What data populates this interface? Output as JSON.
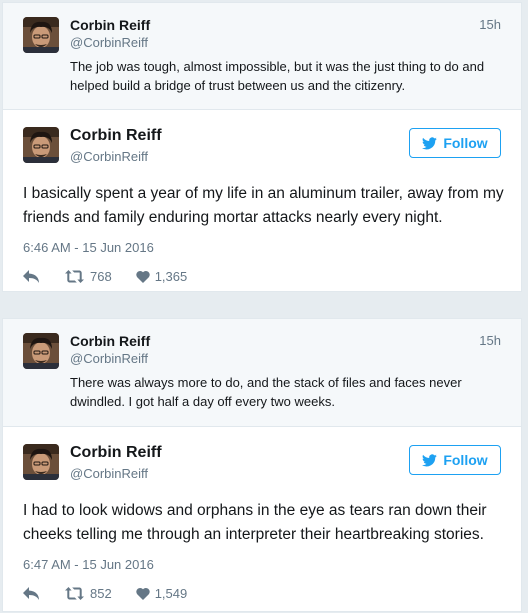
{
  "thread": [
    {
      "parent": {
        "name": "Corbin Reiff",
        "handle": "@CorbinReiff",
        "time": "15h",
        "text": "The job was tough, almost impossible, but it was the just thing to do and helped build a bridge of trust between us and the citizenry."
      },
      "tweet": {
        "name": "Corbin Reiff",
        "handle": "@CorbinReiff",
        "follow_label": "Follow",
        "text": "I basically spent a year of my life in an aluminum trailer, away from my friends and family enduring mortar attacks nearly every night.",
        "date": "6:46 AM - 15 Jun 2016",
        "retweets": "768",
        "likes": "1,365"
      }
    },
    {
      "parent": {
        "name": "Corbin Reiff",
        "handle": "@CorbinReiff",
        "time": "15h",
        "text": "There was always more to do, and the stack of files and faces never dwindled. I got half a day off every two weeks."
      },
      "tweet": {
        "name": "Corbin Reiff",
        "handle": "@CorbinReiff",
        "follow_label": "Follow",
        "text": "I had to look widows and orphans in the eye as tears ran down their cheeks telling me through an interpreter their heartbreaking stories.",
        "date": "6:47 AM - 15 Jun 2016",
        "retweets": "852",
        "likes": "1,549"
      }
    }
  ],
  "icons": {
    "follow": "bird-icon",
    "reply": "reply-icon",
    "retweet": "retweet-icon",
    "like": "heart-icon"
  },
  "colors": {
    "accent": "#1da1f2",
    "secondary_text": "#657786",
    "parent_bg": "#f5f8fa",
    "page_bg": "#e6ecf0"
  }
}
